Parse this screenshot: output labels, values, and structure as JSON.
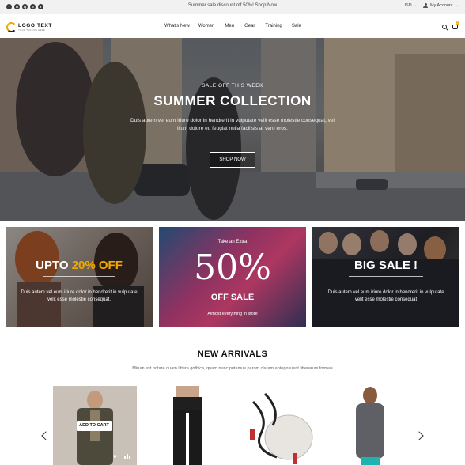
{
  "topbar": {
    "social": [
      "f",
      "in",
      "ig",
      "p",
      "t"
    ],
    "social_icons": [
      "facebook-icon",
      "linkedin-icon",
      "instagram-icon",
      "pinterest-icon",
      "twitter-icon"
    ],
    "promo_text": "Summer sale discount off 50%! Shop Now",
    "currency": "USD",
    "account_label": "My Account"
  },
  "header": {
    "logo_text": "LOGO TEXT",
    "logo_tagline": "YOUR TAGLINE HERE",
    "nav": [
      "What's New",
      "Women",
      "Men",
      "Gear",
      "Training",
      "Sale"
    ],
    "cart_count": "0"
  },
  "hero": {
    "subtitle": "SALE OFF THIS WEEK",
    "title": "SUMMER COLLECTION",
    "description": "Duis autem vel eum iriure dolor in hendrerit in vulputate velit esse molestie consequat, vel illum dolore eu feugiat nulla facilisis at vero eros.",
    "button": "SHOP NOW"
  },
  "banners": {
    "b1": {
      "title_pre": "UPTO ",
      "title_accent": "20% OFF",
      "description": "Duis autem vel eum iriure dolor in hendrerit in vulputate velit esse molestie consequat."
    },
    "b2": {
      "pre": "Take an Extra",
      "big": "50%",
      "off": "OFF SALE",
      "note": "Almost everything in store"
    },
    "b3": {
      "title": "BIG SALE !",
      "description": "Duis autem vel eum iriure dolor in hendrerit in vulputate velit esse molestie consequat"
    }
  },
  "new_arrivals": {
    "title": "NEW ARRIVALS",
    "subtitle": "Mirum est notare quam littera gothica, quam nunc putamus parum claram anteposuerit litterarum formas",
    "add_to_cart": "ADD TO CART"
  },
  "colors": {
    "accent": "#f2a900",
    "topbar_bg": "#f1f1f1",
    "text_dark": "#222222"
  }
}
